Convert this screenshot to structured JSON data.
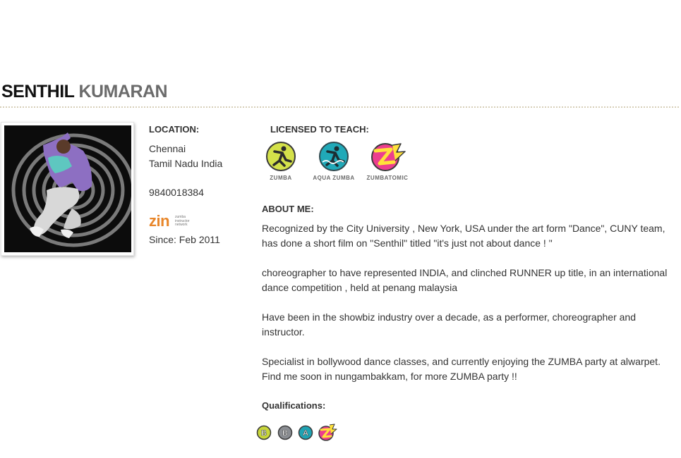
{
  "profile": {
    "first_name": "SENTHIL",
    "last_name": "KUMARAN"
  },
  "location": {
    "heading": "LOCATION:",
    "city": "Chennai",
    "region": "Tamil Nadu India",
    "phone": "9840018384"
  },
  "zin": {
    "logo_text": "zin",
    "logo_subtext": "zumba instructor network",
    "since": "Since: Feb 2011"
  },
  "licensed": {
    "heading": "LICENSED TO TEACH:",
    "items": [
      {
        "label": "ZUMBA",
        "icon": "zumba-logo-icon",
        "color": "#d4e14a"
      },
      {
        "label": "AQUA ZUMBA",
        "icon": "aqua-zumba-logo-icon",
        "color": "#20a9b8"
      },
      {
        "label": "ZUMBATOMIC",
        "icon": "zumbatomic-logo-icon",
        "color": "#ec3e8e"
      }
    ]
  },
  "about": {
    "heading": "ABOUT ME:",
    "paragraphs": [
      "Recognized by the City University , New York, USA under the art form \"Dance\", CUNY team, has done a short film on \"Senthil\" titled \"it's just not about dance ! \"",
      "choreographer to have represented INDIA, and clinched RUNNER up title, in an international dance competition , held at penang malaysia",
      "Have been in the showbiz industry over a decade, as a performer, choreographer and instructor.",
      "Specialist in bollywood dance classes, and currently enjoying the ZUMBA party at alwarpet. Find me soon in nungambakkam, for more ZUMBA party !!"
    ]
  },
  "qualifications": {
    "heading": "Qualifications:",
    "badges": [
      {
        "letter": "B",
        "icon": "basic-1-badge-icon",
        "color": "#c8d63a"
      },
      {
        "letter": "B",
        "icon": "basic-2-badge-icon",
        "color": "#8a8d92"
      },
      {
        "letter": "A",
        "icon": "aqua-badge-icon",
        "color": "#1fa3b3"
      },
      {
        "letter": "",
        "icon": "zumbatomic-badge-icon",
        "color": "#ec3e8e"
      }
    ]
  }
}
